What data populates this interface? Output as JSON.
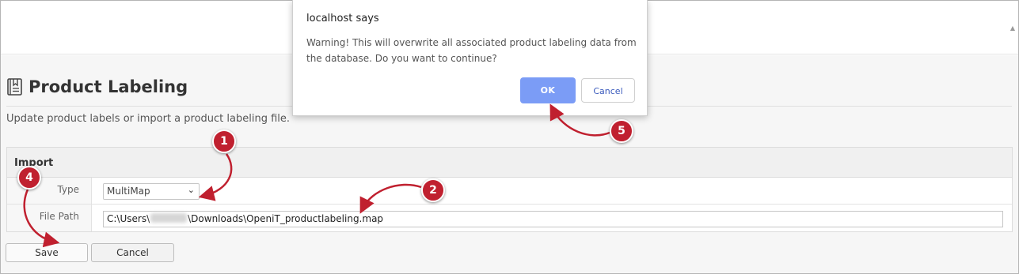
{
  "dialog": {
    "title": "localhost says",
    "message": "Warning! This will overwrite all associated product labeling data from the database. Do you want to continue?",
    "ok_label": "OK",
    "cancel_label": "Cancel",
    "ok_color": "#7b9cf6"
  },
  "page": {
    "title": "Product Labeling",
    "subtitle": "Update product labels or import a product labeling file."
  },
  "import": {
    "heading": "Import",
    "type_label": "Type",
    "type_value": "MultiMap",
    "file_path_label": "File Path",
    "file_path_prefix": "C:\\Users\\",
    "file_path_suffix": "\\Downloads\\OpeniT_productlabeling.map"
  },
  "actions": {
    "save_label": "Save",
    "cancel_label": "Cancel"
  },
  "callouts": {
    "marker_color": "#c0202f",
    "steps": [
      "1",
      "2",
      "4",
      "5"
    ]
  }
}
